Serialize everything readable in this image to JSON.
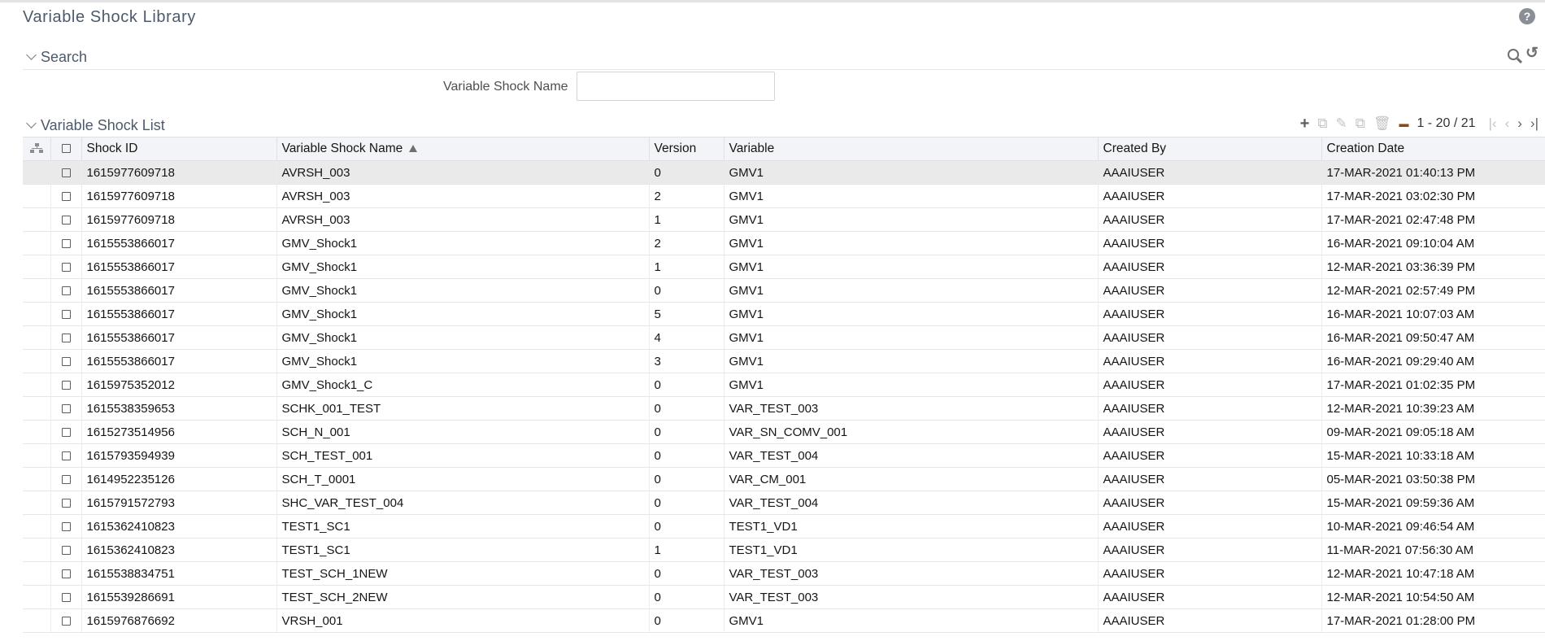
{
  "page": {
    "title": "Variable Shock Library"
  },
  "search": {
    "title": "Search",
    "field_label": "Variable Shock Name",
    "field_value": ""
  },
  "list": {
    "title": "Variable Shock List",
    "pager": {
      "range": "1 - 20 / 21"
    },
    "columns": [
      "Shock ID",
      "Variable Shock Name",
      "Version",
      "Variable",
      "Created By",
      "Creation Date"
    ],
    "rows": [
      [
        "1615977609718",
        "AVRSH_003",
        "0",
        "GMV1",
        "AAAIUSER",
        "17-MAR-2021 01:40:13 PM"
      ],
      [
        "1615977609718",
        "AVRSH_003",
        "2",
        "GMV1",
        "AAAIUSER",
        "17-MAR-2021 03:02:30 PM"
      ],
      [
        "1615977609718",
        "AVRSH_003",
        "1",
        "GMV1",
        "AAAIUSER",
        "17-MAR-2021 02:47:48 PM"
      ],
      [
        "1615553866017",
        "GMV_Shock1",
        "2",
        "GMV1",
        "AAAIUSER",
        "16-MAR-2021 09:10:04 AM"
      ],
      [
        "1615553866017",
        "GMV_Shock1",
        "1",
        "GMV1",
        "AAAIUSER",
        "12-MAR-2021 03:36:39 PM"
      ],
      [
        "1615553866017",
        "GMV_Shock1",
        "0",
        "GMV1",
        "AAAIUSER",
        "12-MAR-2021 02:57:49 PM"
      ],
      [
        "1615553866017",
        "GMV_Shock1",
        "5",
        "GMV1",
        "AAAIUSER",
        "16-MAR-2021 10:07:03 AM"
      ],
      [
        "1615553866017",
        "GMV_Shock1",
        "4",
        "GMV1",
        "AAAIUSER",
        "16-MAR-2021 09:50:47 AM"
      ],
      [
        "1615553866017",
        "GMV_Shock1",
        "3",
        "GMV1",
        "AAAIUSER",
        "16-MAR-2021 09:29:40 AM"
      ],
      [
        "1615975352012",
        "GMV_Shock1_C",
        "0",
        "GMV1",
        "AAAIUSER",
        "17-MAR-2021 01:02:35 PM"
      ],
      [
        "1615538359653",
        "SCHK_001_TEST",
        "0",
        "VAR_TEST_003",
        "AAAIUSER",
        "12-MAR-2021 10:39:23 AM"
      ],
      [
        "1615273514956",
        "SCH_N_001",
        "0",
        "VAR_SN_COMV_001",
        "AAAIUSER",
        "09-MAR-2021 09:05:18 AM"
      ],
      [
        "1615793594939",
        "SCH_TEST_001",
        "0",
        "VAR_TEST_004",
        "AAAIUSER",
        "15-MAR-2021 10:33:18 AM"
      ],
      [
        "1614952235126",
        "SCH_T_0001",
        "0",
        "VAR_CM_001",
        "AAAIUSER",
        "05-MAR-2021 03:50:38 PM"
      ],
      [
        "1615791572793",
        "SHC_VAR_TEST_004",
        "0",
        "VAR_TEST_004",
        "AAAIUSER",
        "15-MAR-2021 09:59:36 AM"
      ],
      [
        "1615362410823",
        "TEST1_SC1",
        "0",
        "TEST1_VD1",
        "AAAIUSER",
        "10-MAR-2021 09:46:54 AM"
      ],
      [
        "1615362410823",
        "TEST1_SC1",
        "1",
        "TEST1_VD1",
        "AAAIUSER",
        "11-MAR-2021 07:56:30 AM"
      ],
      [
        "1615538834751",
        "TEST_SCH_1NEW",
        "0",
        "VAR_TEST_003",
        "AAAIUSER",
        "12-MAR-2021 10:47:18 AM"
      ],
      [
        "1615539286691",
        "TEST_SCH_2NEW",
        "0",
        "VAR_TEST_003",
        "AAAIUSER",
        "12-MAR-2021 10:54:50 AM"
      ],
      [
        "1615976876692",
        "VRSH_001",
        "0",
        "GMV1",
        "AAAIUSER",
        "17-MAR-2021 01:28:00 PM"
      ]
    ]
  },
  "icons": {
    "help": "?",
    "reset": "↺",
    "add": "+",
    "copy": "⧉",
    "edit": "✎",
    "delete": "🗑",
    "first": "|‹",
    "prev": "‹",
    "next": "›",
    "last": "›|"
  }
}
